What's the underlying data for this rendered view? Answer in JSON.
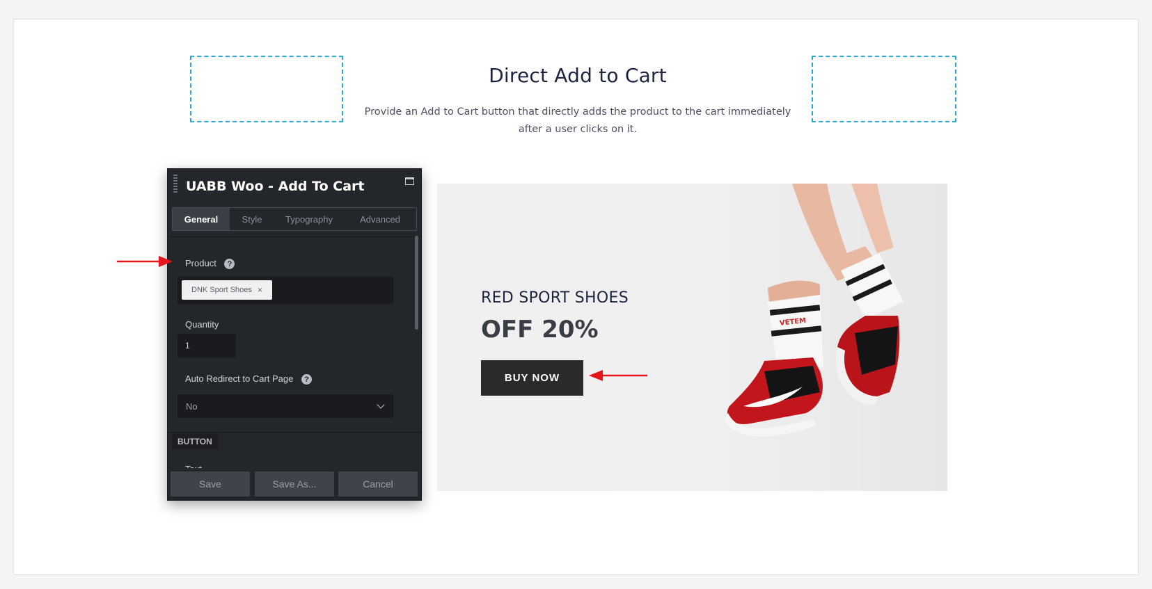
{
  "page": {
    "heading": "Direct Add to Cart",
    "subtitle_line1": "Provide an Add to Cart button that directly adds the product to the cart immediately",
    "subtitle_line2": "after a user clicks on it."
  },
  "panel": {
    "title": "UABB Woo - Add To Cart",
    "tabs": [
      {
        "label": "General",
        "active": true
      },
      {
        "label": "Style",
        "active": false
      },
      {
        "label": "Typography",
        "active": false
      },
      {
        "label": "Advanced",
        "active": false
      }
    ],
    "product": {
      "label": "Product",
      "help": "?",
      "selected": "DNK Sport Shoes",
      "remove": "×"
    },
    "quantity": {
      "label": "Quantity",
      "value": "1"
    },
    "redirect": {
      "label": "Auto Redirect to Cart Page",
      "help": "?",
      "value": "No"
    },
    "section_button": "BUTTON",
    "partial_label": "Text",
    "footer": {
      "save": "Save",
      "save_as": "Save As...",
      "cancel": "Cancel"
    }
  },
  "banner": {
    "title": "RED SPORT SHOES",
    "discount": "OFF 20%",
    "button": "BUY NOW",
    "sock_text": "VETEM"
  },
  "colors": {
    "accent_dashed": "#2aa6cf",
    "panel_bg": "#23262b",
    "arrow": "#e8141b",
    "heading": "#1d2440",
    "button_bg": "#2a2a2a"
  }
}
